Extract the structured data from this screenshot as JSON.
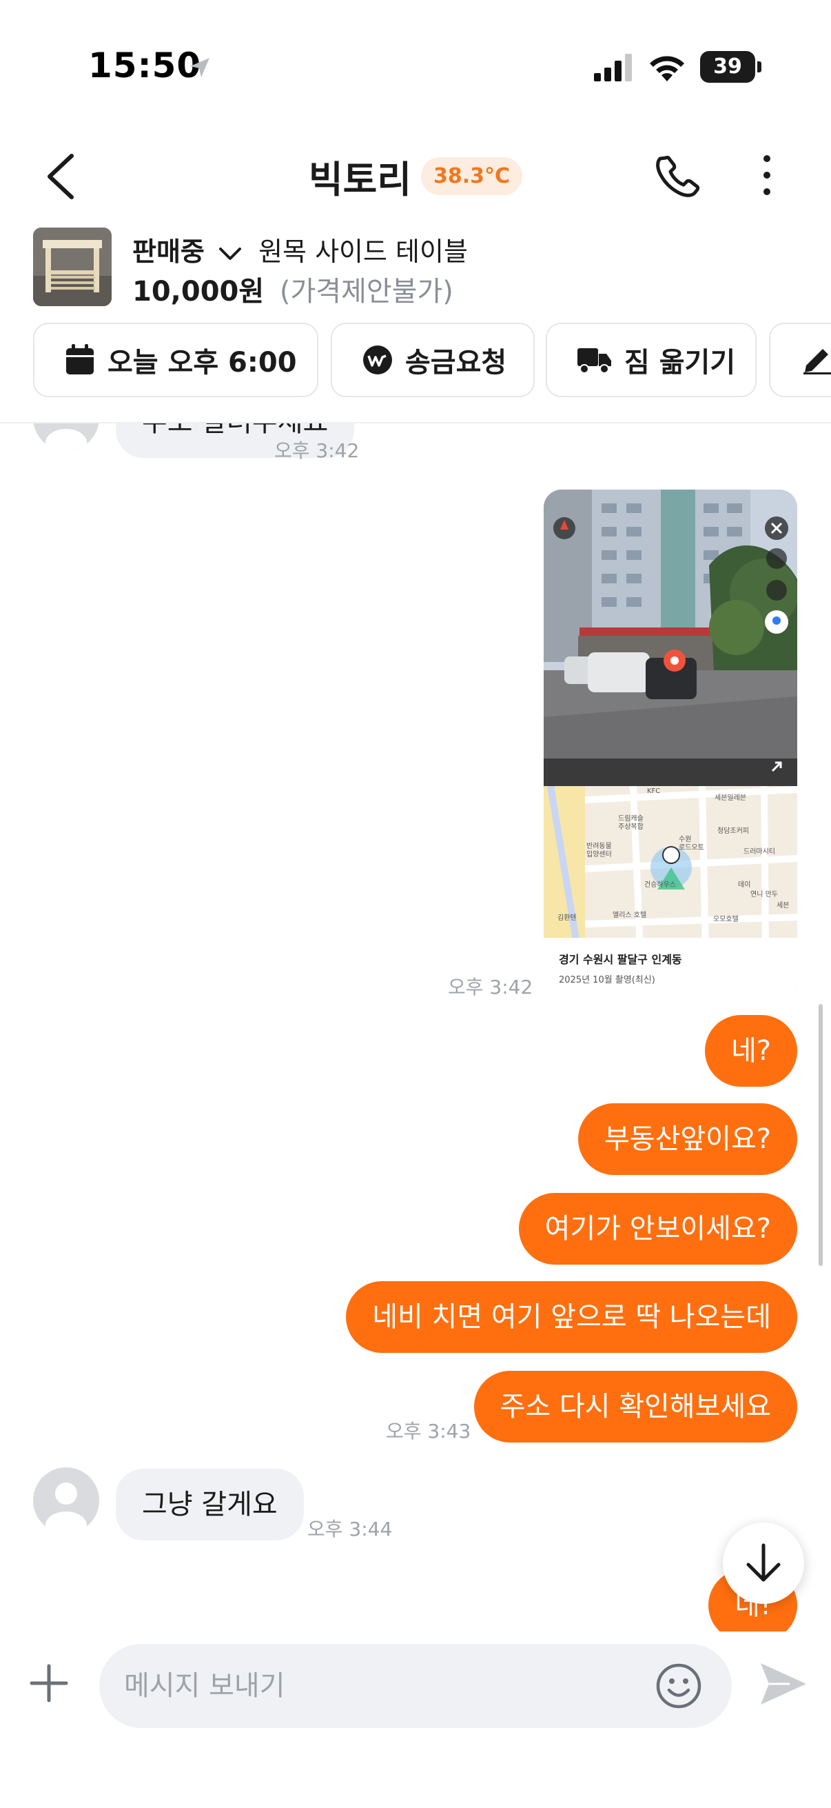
{
  "status_bar": {
    "time": "15:50",
    "battery": "39"
  },
  "header": {
    "title": "빅토리",
    "temperature": "38.3°C"
  },
  "product": {
    "status": "판매중",
    "name": "원목 사이드 테이블",
    "price": "10,000원",
    "price_note": "(가격제안불가)"
  },
  "actions": [
    {
      "label": "오늘 오후 6:00",
      "icon": "calendar-icon"
    },
    {
      "label": "송금요청",
      "icon": "pay-icon"
    },
    {
      "label": "짐 옮기기",
      "icon": "truck-icon"
    },
    {
      "label": "",
      "icon": "pencil-icon"
    }
  ],
  "messages": {
    "m0": {
      "text": "주소 알려주세요",
      "time": "오후 3:42"
    },
    "map": {
      "time": "오후 3:42",
      "caption": "경기 수원시 팔달구 인계동",
      "caption_sub": "2025년 10월 촬영(최신)",
      "labels": [
        "KFC",
        "세븐일레븐",
        "드림캐슬",
        "주상복합",
        "청담조커피",
        "반려동물",
        "입양센터",
        "수원",
        "로드오토",
        "드러마시티",
        "건승하우스",
        "데이",
        "연니 만두",
        "엘리스 호텔",
        "오모호텔",
        "김환텐",
        "세븐"
      ]
    },
    "m1": {
      "text": "네?"
    },
    "m2": {
      "text": "부동산앞이요?"
    },
    "m3": {
      "text": "여기가 안보이세요?"
    },
    "m4": {
      "text": "네비 치면 여기 앞으로 딱 나오는데"
    },
    "m5": {
      "text": "주소 다시 확인해보세요",
      "time": "오후 3:43"
    },
    "m6": {
      "text": "그냥 갈게요",
      "time": "오후 3:44"
    },
    "m7": {
      "text": "네!"
    }
  },
  "input": {
    "placeholder": "메시지 보내기"
  }
}
